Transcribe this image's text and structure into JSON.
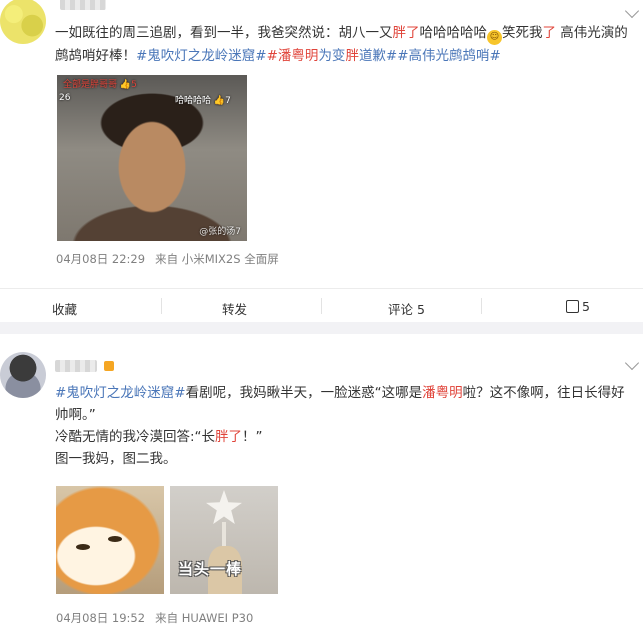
{
  "post1": {
    "text_a": "一如既往的周三追剧，看到一半，我爸突然说：胡八一又",
    "text_red1": "胖了",
    "text_b": "哈哈哈哈哈",
    "emoji": "😂",
    "text_c": "笑死我",
    "text_red2": "了",
    "text_d": " 高伟光演的鹧鸪哨好棒！",
    "tag1": "#鬼吹灯之龙岭迷窟#",
    "tag2_red": "#潘粤明",
    "tag2_mid": "为变",
    "tag2_red2": "胖",
    "tag2_end": "道歉#",
    "tag3": "#高伟光鹧鸪哨#",
    "image": {
      "overlay_top": "全部是胖哥哥",
      "overlay_top_count": "5",
      "overlay_left": "26",
      "overlay_right": "哈哈哈哈",
      "overlay_right_count": "7",
      "watermark": "@张的汤7"
    },
    "meta_time": "04月08日 22:29",
    "meta_source": "来自 小米MIX2S 全面屏",
    "actions": {
      "favorite": "收藏",
      "forward": "转发",
      "comment": "评论 5",
      "like_count": "5"
    }
  },
  "post2": {
    "tag1": "#鬼吹灯之龙岭迷窟#",
    "text_a": "看剧呢，我妈瞅半天，一脸迷惑“这哪是",
    "red1": "潘粤明",
    "text_b": "啦？这不像啊，往日长得好帅啊。”",
    "line2_a": "冷酷无情的我冷漠回答:“长",
    "line2_red": "胖了",
    "line2_b": "！”",
    "line3": "图一我妈，图二我。",
    "image2_caption": "当头一棒",
    "meta_time": "04月08日 19:52",
    "meta_source": "来自 HUAWEI P30"
  }
}
